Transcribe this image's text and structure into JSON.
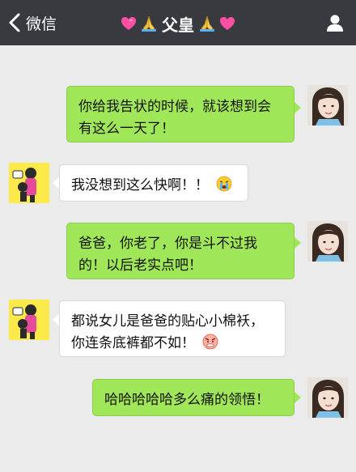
{
  "nav": {
    "back_label": "微信",
    "title": "父皇",
    "title_decor_left": [
      "heart-emoji",
      "pray-emoji"
    ],
    "title_decor_right": [
      "pray-emoji",
      "heart-emoji"
    ]
  },
  "colors": {
    "nav_bg": "#393a3f",
    "chat_bg": "#ebebeb",
    "my_bubble": "#9fe658",
    "their_bubble": "#ffffff"
  },
  "messages": [
    {
      "sender": "me",
      "text": "你给我告状的时候，就该想到会有这么一天了！"
    },
    {
      "sender": "them",
      "text": "我没想到这么快啊！！",
      "emoji": "crying-face-emoji"
    },
    {
      "sender": "me",
      "text": "爸爸，你老了，你是斗不过我的！以后老实点吧！"
    },
    {
      "sender": "them",
      "text": "都说女儿是爸爸的贴心小棉袄，你连条底裤都不如！",
      "emoji": "angry-face-emoji"
    },
    {
      "sender": "me",
      "text": "哈哈哈哈哈多么痛的领悟！"
    }
  ]
}
